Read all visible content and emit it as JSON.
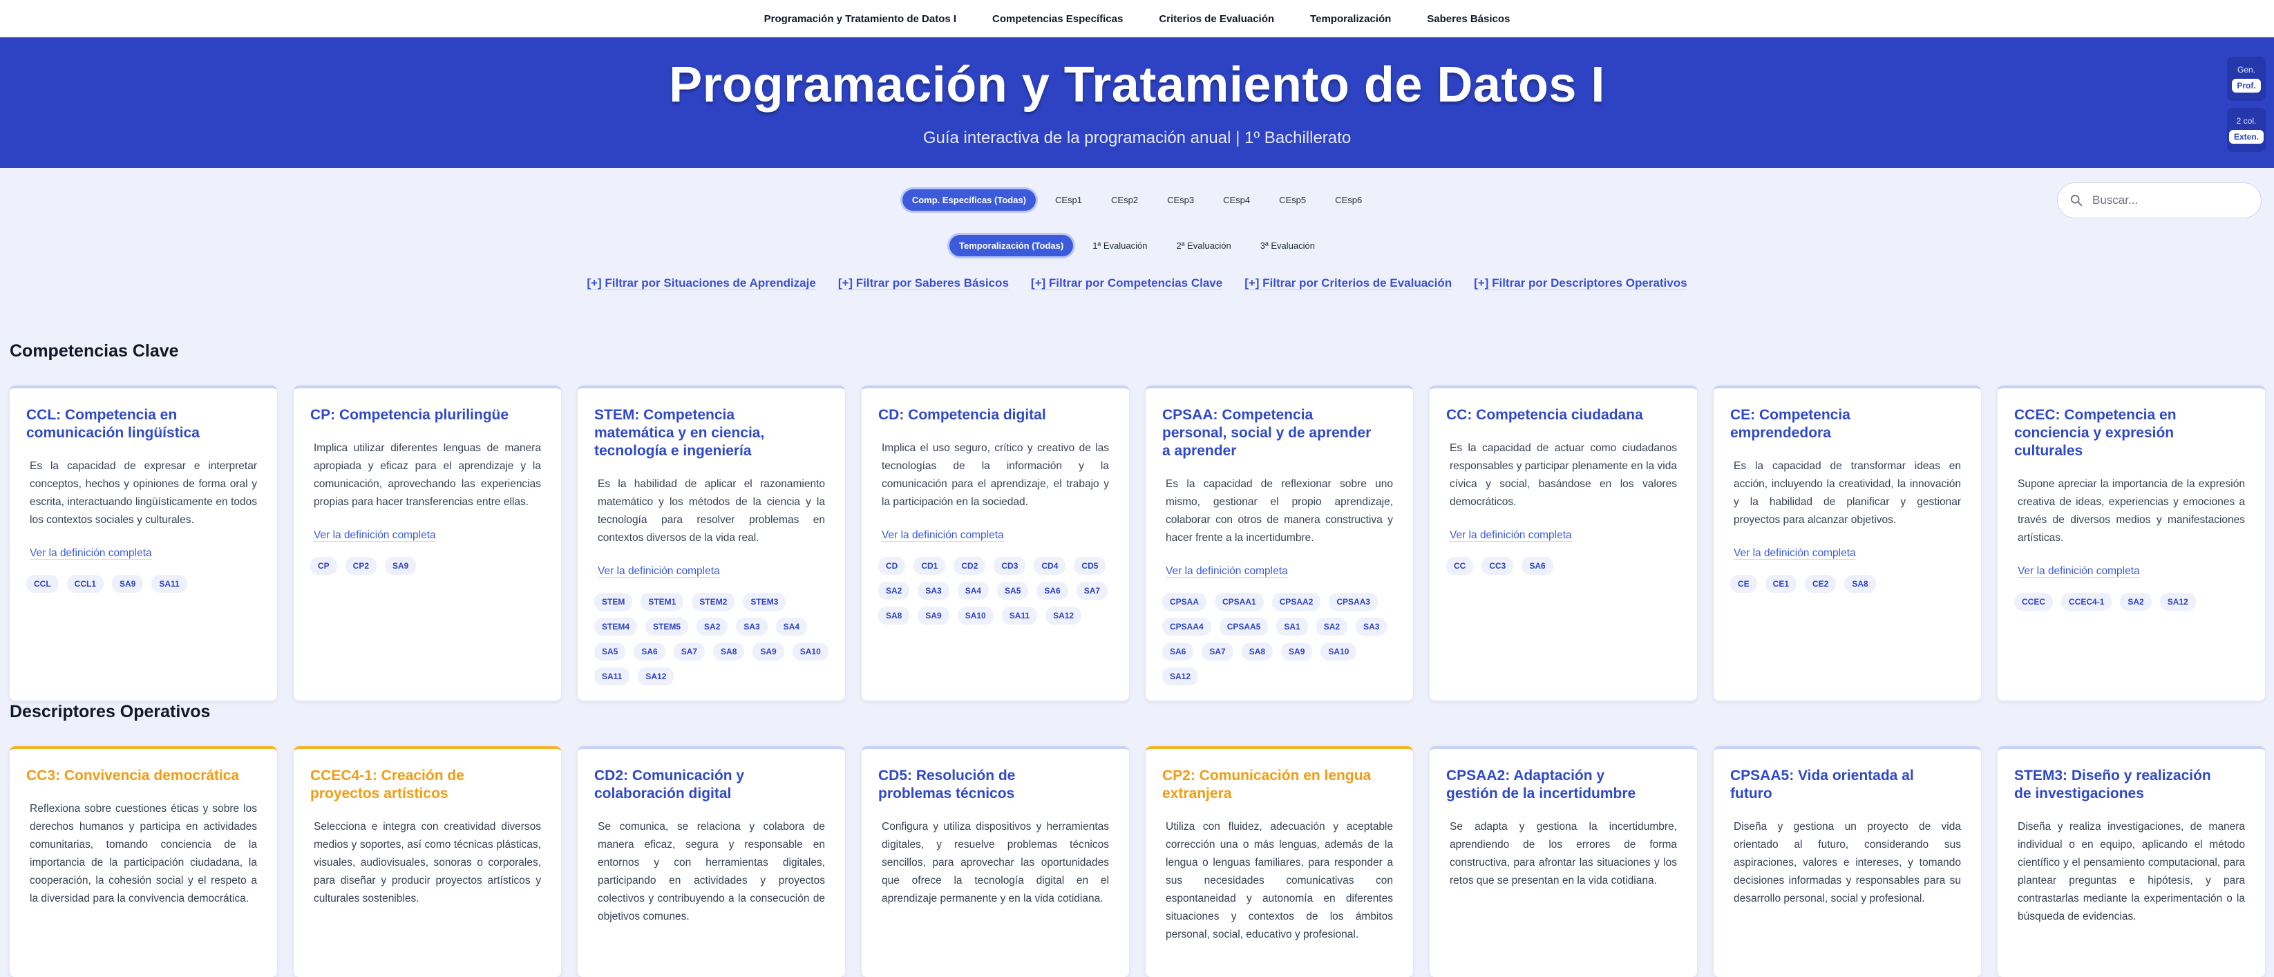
{
  "nav": [
    "Programación y Tratamiento de Datos I",
    "Competencias Específicas",
    "Criterios de Evaluación",
    "Temporalización",
    "Saberes Básicos"
  ],
  "header": {
    "title": "Programación y Tratamiento de Datos I",
    "subtitle": "Guía interactiva de la programación anual | 1º Bachillerato",
    "ctrl_gen": {
      "label": "Gen.",
      "button": "Prof."
    },
    "ctrl_col": {
      "label": "2 col.",
      "button": "Exten."
    }
  },
  "filters": {
    "competencias": [
      "Comp. Específicas (Todas)",
      "CEsp1",
      "CEsp2",
      "CEsp3",
      "CEsp4",
      "CEsp5",
      "CEsp6"
    ],
    "temporalizacion": [
      "Temporalización (Todas)",
      "1ª Evaluación",
      "2ª Evaluación",
      "3ª Evaluación"
    ],
    "links": [
      "[+] Filtrar por Situaciones de Aprendizaje",
      "[+] Filtrar por Saberes Básicos",
      "[+] Filtrar por Competencias Clave",
      "[+] Filtrar por Criterios de Evaluación",
      "[+] Filtrar por Descriptores Operativos"
    ]
  },
  "search": {
    "placeholder": "Buscar..."
  },
  "sections": {
    "clave": {
      "title": "Competencias Clave",
      "more_label": "Ver la definición completa",
      "cards": [
        {
          "title": "CCL: Competencia en comunicación lingüística",
          "text": "Es la capacidad de expresar e interpretar conceptos, hechos y opiniones de forma oral y escrita, interactuando lingüísticamente en todos los contextos sociales y culturales.",
          "tags": [
            "CCL",
            "CCL1",
            "SA9",
            "SA11"
          ]
        },
        {
          "title": "CP: Competencia plurilingüe",
          "text": "Implica utilizar diferentes lenguas de manera apropiada y eficaz para el aprendizaje y la comunicación, aprovechando las experiencias propias para hacer transferencias entre ellas.",
          "tags": [
            "CP",
            "CP2",
            "SA9"
          ]
        },
        {
          "title": "STEM: Competencia matemática y en ciencia, tecnología e ingeniería",
          "text": "Es la habilidad de aplicar el razonamiento matemático y los métodos de la ciencia y la tecnología para resolver problemas en contextos diversos de la vida real.",
          "tags": [
            "STEM",
            "STEM1",
            "STEM2",
            "STEM3",
            "STEM4",
            "STEM5",
            "SA2",
            "SA3",
            "SA4",
            "SA5",
            "SA6",
            "SA7",
            "SA8",
            "SA9",
            "SA10",
            "SA11",
            "SA12"
          ]
        },
        {
          "title": "CD: Competencia digital",
          "text": "Implica el uso seguro, crítico y creativo de las tecnologías de la información y la comunicación para el aprendizaje, el trabajo y la participación en la sociedad.",
          "tags": [
            "CD",
            "CD1",
            "CD2",
            "CD3",
            "CD4",
            "CD5",
            "SA2",
            "SA3",
            "SA4",
            "SA5",
            "SA6",
            "SA7",
            "SA8",
            "SA9",
            "SA10",
            "SA11",
            "SA12"
          ]
        },
        {
          "title": "CPSAA: Competencia personal, social y de aprender a aprender",
          "text": "Es la capacidad de reflexionar sobre uno mismo, gestionar el propio aprendizaje, colaborar con otros de manera constructiva y hacer frente a la incertidumbre.",
          "tags": [
            "CPSAA",
            "CPSAA1",
            "CPSAA2",
            "CPSAA3",
            "CPSAA4",
            "CPSAA5",
            "SA1",
            "SA2",
            "SA3",
            "SA6",
            "SA7",
            "SA8",
            "SA9",
            "SA10",
            "SA12"
          ]
        },
        {
          "title": "CC: Competencia ciudadana",
          "text": "Es la capacidad de actuar como ciudadanos responsables y participar plenamente en la vida cívica y social, basándose en los valores democráticos.",
          "tags": [
            "CC",
            "CC3",
            "SA6"
          ]
        },
        {
          "title": "CE: Competencia emprendedora",
          "text": "Es la capacidad de transformar ideas en acción, incluyendo la creatividad, la innovación y la habilidad de planificar y gestionar proyectos para alcanzar objetivos.",
          "tags": [
            "CE",
            "CE1",
            "CE2",
            "SA8"
          ]
        },
        {
          "title": "CCEC: Competencia en conciencia y expresión culturales",
          "text": "Supone apreciar la importancia de la expresión creativa de ideas, experiencias y emociones a través de diversos medios y manifestaciones artísticas.",
          "tags": [
            "CCEC",
            "CCEC4-1",
            "SA2",
            "SA12"
          ]
        }
      ]
    },
    "descriptores": {
      "title": "Descriptores Operativos",
      "cards": [
        {
          "title": "CC3: Convivencia democrática",
          "orange": true,
          "text": "Reflexiona sobre cuestiones éticas y sobre los derechos humanos y participa en actividades comunitarias, tomando conciencia de la importancia de la participación ciudadana, la cooperación, la cohesión social y el respeto a la diversidad para la convivencia democrática."
        },
        {
          "title": "CCEC4-1: Creación de proyectos artísticos",
          "orange": true,
          "text": "Selecciona e integra con creatividad diversos medios y soportes, así como técnicas plásticas, visuales, audiovisuales, sonoras o corporales, para diseñar y producir proyectos artísticos y culturales sostenibles."
        },
        {
          "title": "CD2: Comunicación y colaboración digital",
          "orange": false,
          "text": "Se comunica, se relaciona y colabora de manera eficaz, segura y responsable en entornos y con herramientas digitales, participando en actividades y proyectos colectivos y contribuyendo a la consecución de objetivos comunes."
        },
        {
          "title": "CD5: Resolución de problemas técnicos",
          "orange": false,
          "text": "Configura y utiliza dispositivos y herramientas digitales, y resuelve problemas técnicos sencillos, para aprovechar las oportunidades que ofrece la tecnología digital en el aprendizaje permanente y en la vida cotidiana."
        },
        {
          "title": "CP2: Comunicación en lengua extranjera",
          "orange": true,
          "text": "Utiliza con fluidez, adecuación y aceptable corrección una o más lenguas, además de la lengua o lenguas familiares, para responder a sus necesidades comunicativas con espontaneidad y autonomía en diferentes situaciones y contextos de los ámbitos personal, social, educativo y profesional."
        },
        {
          "title": "CPSAA2: Adaptación y gestión de la incertidumbre",
          "orange": false,
          "text": "Se adapta y gestiona la incertidumbre, aprendiendo de los errores de forma constructiva, para afrontar las situaciones y los retos que se presentan en la vida cotidiana."
        },
        {
          "title": "CPSAA5: Vida orientada al futuro",
          "orange": false,
          "text": "Diseña y gestiona un proyecto de vida orientado al futuro, considerando sus aspiraciones, valores e intereses, y tomando decisiones informadas y responsables para su desarrollo personal, social y profesional."
        },
        {
          "title": "STEM3: Diseño y realización de investigaciones",
          "orange": false,
          "text": "Diseña y realiza investigaciones, de manera individual o en equipo, aplicando el método científico y el pensamiento computacional, para plantear preguntas e hipótesis, y para contrastarlas mediante la experimentación o la búsqueda de evidencias."
        }
      ]
    }
  }
}
